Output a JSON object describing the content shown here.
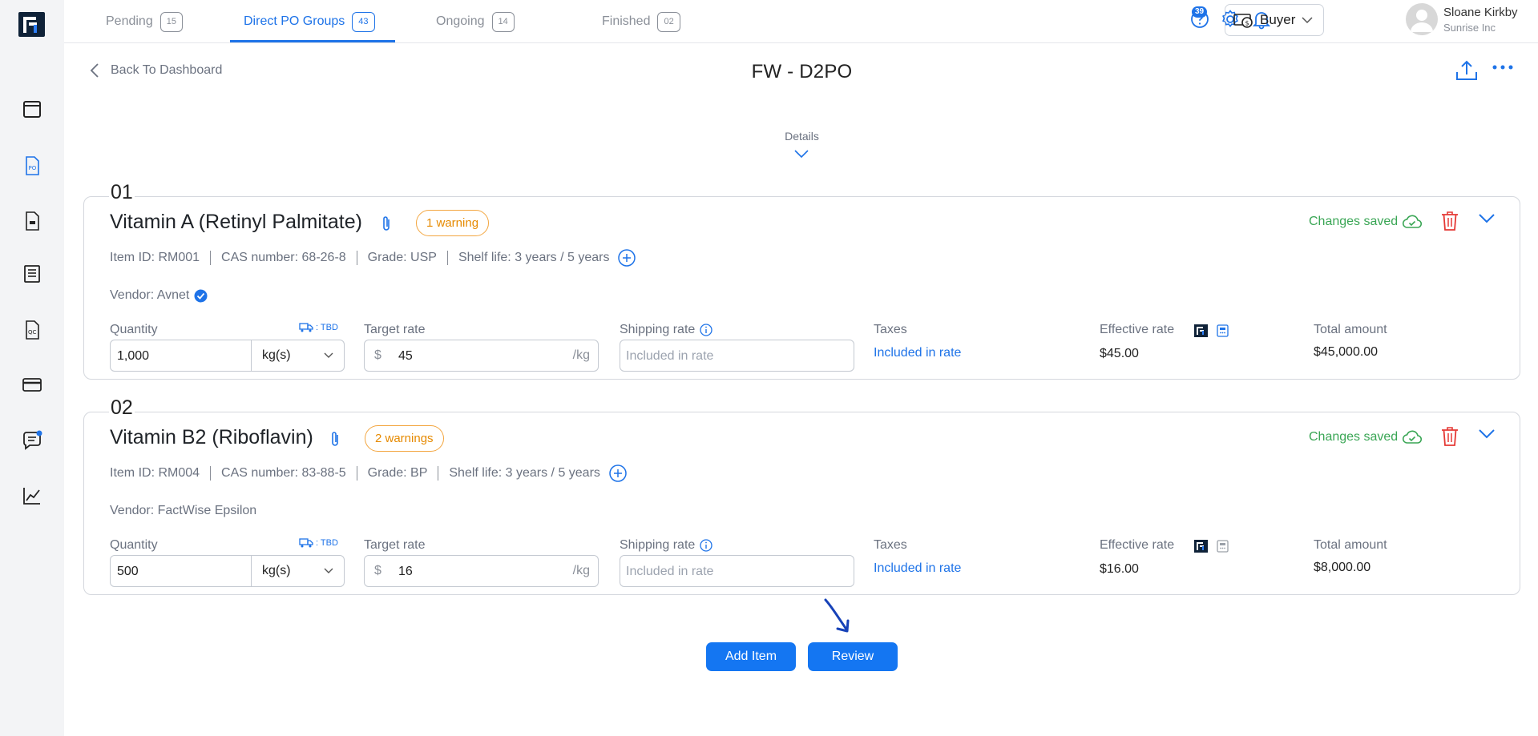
{
  "tabs": [
    {
      "label": "Pending",
      "count": "15"
    },
    {
      "label": "Direct PO Groups",
      "count": "43"
    },
    {
      "label": "Ongoing",
      "count": "14"
    },
    {
      "label": "Finished",
      "count": "02"
    }
  ],
  "header": {
    "notifications_count": "39",
    "role": "Buyer",
    "user_name": "Sloane Kirkby",
    "user_company": "Sunrise Inc"
  },
  "page": {
    "back_label": "Back To Dashboard",
    "title": "FW - D2PO",
    "details_label": "Details"
  },
  "labels": {
    "quantity": "Quantity",
    "tbd": ": TBD",
    "target_rate": "Target rate",
    "shipping_rate": "Shipping rate",
    "taxes": "Taxes",
    "effective_rate": "Effective rate",
    "total_amount": "Total amount",
    "changes_saved": "Changes saved",
    "currency": "$",
    "per_unit": "/kg",
    "shipping_placeholder": "Included in rate",
    "taxes_value": "Included in rate"
  },
  "items": [
    {
      "number": "01",
      "name": "Vitamin A (Retinyl Palmitate)",
      "warning": "1 warning",
      "item_id": "Item ID: RM001",
      "cas": "CAS number: 68-26-8",
      "grade": "Grade: USP",
      "shelf_life": "Shelf life: 3 years / 5 years",
      "vendor": "Vendor: Avnet",
      "quantity": "1,000",
      "unit": "kg(s)",
      "target_rate": "45",
      "effective_rate": "$45.00",
      "total_amount": "$45,000.00"
    },
    {
      "number": "02",
      "name": "Vitamin B2 (Riboflavin)",
      "warning": "2 warnings",
      "item_id": "Item ID: RM004",
      "cas": "CAS number: 83-88-5",
      "grade": "Grade: BP",
      "shelf_life": "Shelf life: 3 years / 5 years",
      "vendor": "Vendor: FactWise Epsilon",
      "quantity": "500",
      "unit": "kg(s)",
      "target_rate": "16",
      "effective_rate": "$16.00",
      "total_amount": "$8,000.00"
    }
  ],
  "actions": {
    "add_item": "Add Item",
    "review": "Review"
  },
  "colors": {
    "accent": "#1e73e8",
    "saved": "#3aa655",
    "warning": "#e68a00",
    "delete": "#e53935"
  }
}
